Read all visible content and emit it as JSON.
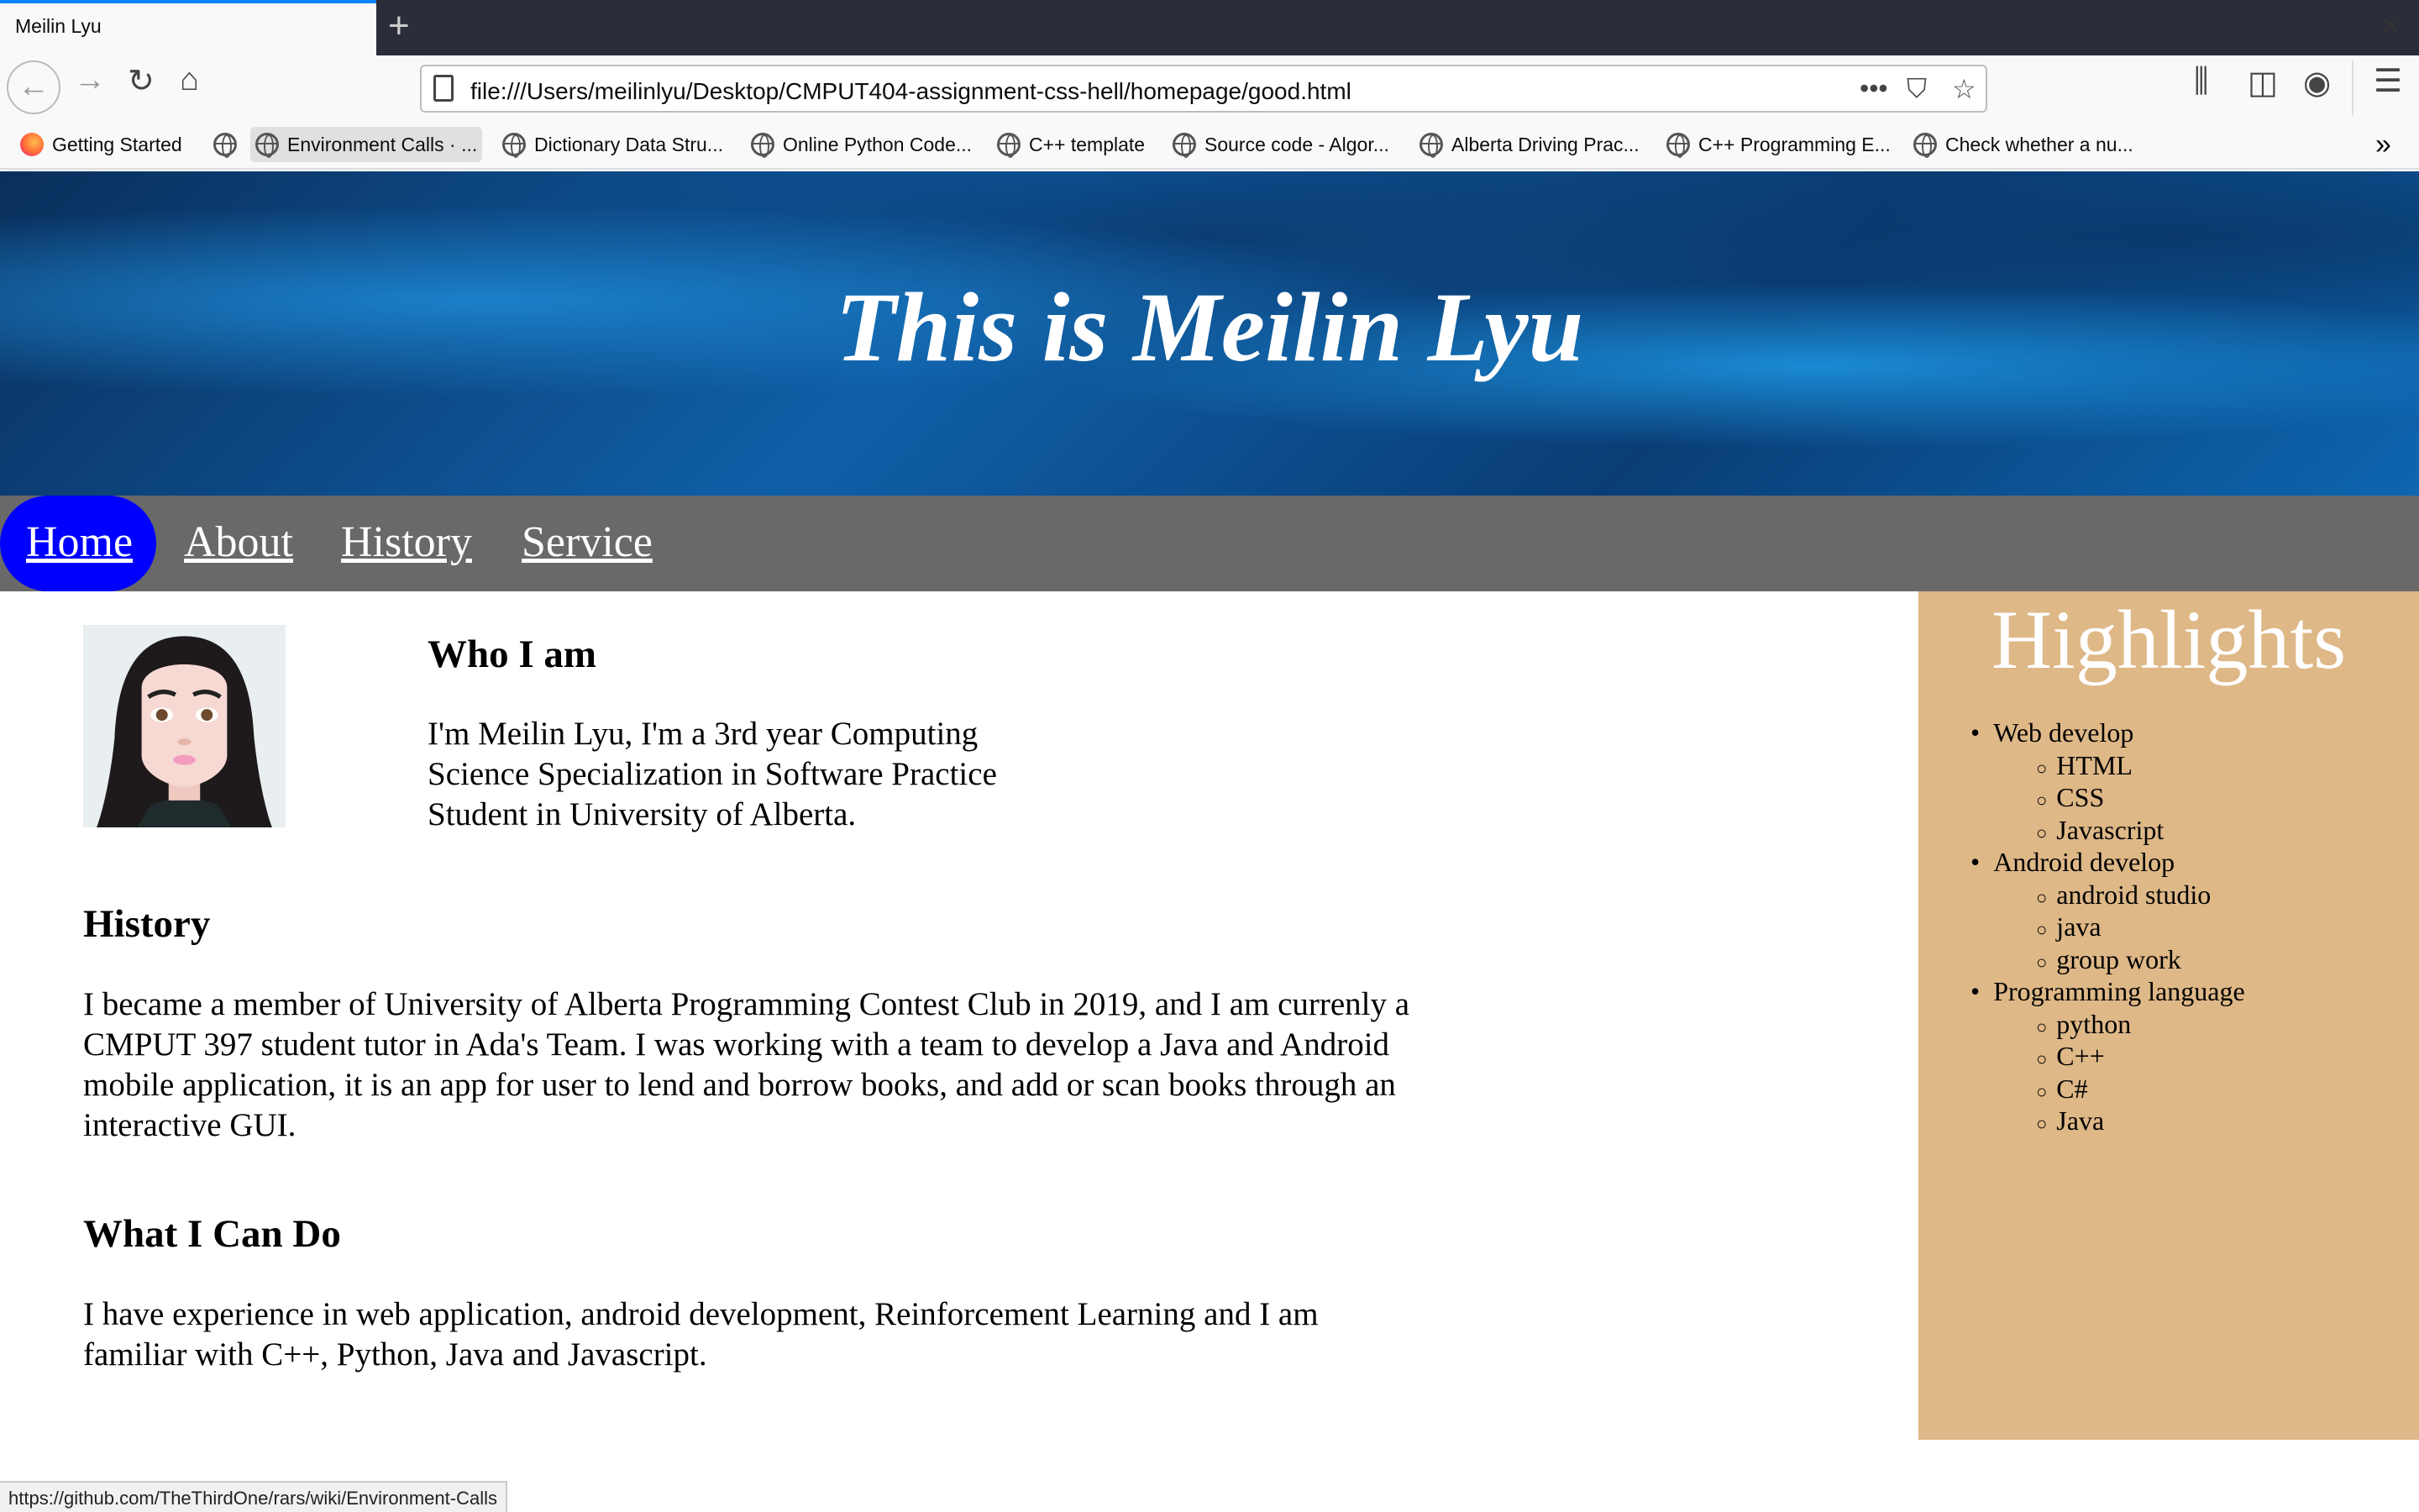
{
  "browser": {
    "tab_title": "Meilin Lyu",
    "url": "file:///Users/meilinlyu/Desktop/CMPUT404-assignment-css-hell/homepage/good.html",
    "bookmarks": [
      "Getting Started",
      "",
      "Environment Calls · ...",
      "Dictionary Data Stru...",
      "Online Python Code...",
      "C++ template",
      "Source code - Algor...",
      "Alberta Driving Prac...",
      "C++ Programming E...",
      "Check whether a nu..."
    ],
    "status_url": "https://github.com/TheThirdOne/rars/wiki/Environment-Calls"
  },
  "page": {
    "banner_title": "This is Meilin Lyu",
    "nav": [
      "Home",
      "About",
      "History",
      "Service"
    ],
    "nav_active": "Home",
    "who": {
      "heading": "Who I am",
      "lines": [
        "I'm Meilin Lyu, I'm a 3rd year Computing",
        "Science Specialization in Software Practice",
        "Student in University of Alberta."
      ]
    },
    "history": {
      "heading": "History",
      "lines": [
        "I became a member of University of Alberta Programming Contest Club in 2019, and I am currenly a",
        "CMPUT 397 student tutor in Ada's Team. I was working with a team to develop a Java and Android",
        "mobile application, it is an app for user to lend and borrow books, and add or scan books through an",
        "interactive GUI."
      ]
    },
    "can_do": {
      "heading": "What I Can Do",
      "lines": [
        "I have experience in web application, android development, Reinforcement Learning and I am",
        "familiar with C++, Python, Java and Javascript."
      ]
    },
    "highlights": {
      "title": "Highlights",
      "groups": [
        {
          "label": "Web develop",
          "items": [
            "HTML",
            "CSS",
            "Javascript"
          ]
        },
        {
          "label": "Android develop",
          "items": [
            "android studio",
            "java",
            "group work"
          ]
        },
        {
          "label": "Programming language",
          "items": [
            "python",
            "C++",
            "C#",
            "Java"
          ]
        }
      ]
    }
  },
  "colors": {
    "nav_bg": "#696969",
    "active_nav": "#0000ff",
    "sidebar_bg": "#deb887"
  }
}
